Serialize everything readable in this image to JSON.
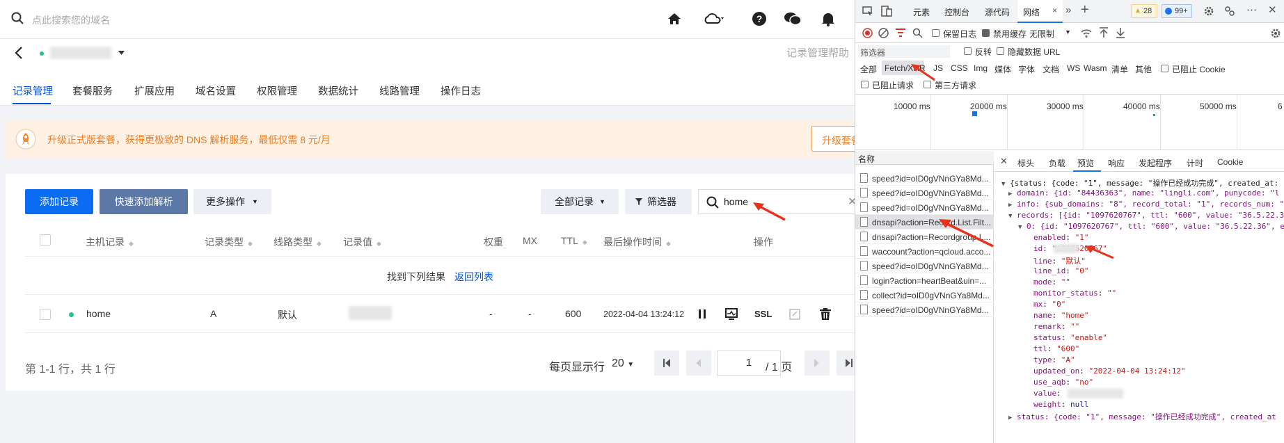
{
  "app": {
    "search_placeholder": "点此搜索您的域名",
    "help_link": "记录管理帮助",
    "tabs": [
      "记录管理",
      "套餐服务",
      "扩展应用",
      "域名设置",
      "权限管理",
      "数据统计",
      "线路管理",
      "操作日志"
    ],
    "banner": {
      "text": "升级正式版套餐，获得更极致的 DNS 解析服务，最低仅需 8 元/月",
      "button": "升级套餐"
    },
    "toolbar": {
      "add_record": "添加记录",
      "quick_add": "快速添加解析",
      "more_actions": "更多操作",
      "all_records": "全部记录",
      "filter": "筛选器",
      "search_value": "home"
    },
    "table": {
      "headers": [
        "主机记录",
        "记录类型",
        "线路类型",
        "记录值",
        "权重",
        "MX",
        "TTL",
        "最后操作时间",
        "操作"
      ],
      "found_text": "找到下列结果",
      "back_link": "返回列表",
      "row": {
        "host": "home",
        "type": "A",
        "line": "默认",
        "weight": "-",
        "mx": "-",
        "ttl": "600",
        "time": "2022-04-04 13:24:12",
        "ssl": "SSL"
      }
    },
    "pagination": {
      "summary": "第 1-1 行，共 1 行",
      "per_page_label": "每页显示行",
      "per_page": "20",
      "page": "1",
      "total_pages": "/ 1 页"
    }
  },
  "devtools": {
    "tabs": [
      "元素",
      "控制台",
      "源代码",
      "网络"
    ],
    "badges": {
      "warnings": "28",
      "messages": "99+"
    },
    "toolbar": {
      "preserve_log": "保留日志",
      "disable_cache": "禁用缓存",
      "throttle": "无限制"
    },
    "filter": {
      "placeholder": "筛选器",
      "invert": "反转",
      "hide_data_urls": "隐藏数据 URL"
    },
    "types": [
      "全部",
      "Fetch/XHR",
      "JS",
      "CSS",
      "Img",
      "媒体",
      "字体",
      "文档",
      "WS",
      "Wasm",
      "清单",
      "其他"
    ],
    "blocked_cookies": "已阻止 Cookie",
    "blocked_requests": "已阻止请求",
    "third_party": "第三方请求",
    "timeline": [
      "10000 ms",
      "20000 ms",
      "30000 ms",
      "40000 ms",
      "50000 ms",
      "6"
    ],
    "name_header": "名称",
    "requests": [
      "speed?id=oID0gVNnGYa8Md...",
      "speed?id=oID0gVNnGYa8Md...",
      "speed?id=oID0gVNnGYa8Md...",
      "dnsapi?action=Record.List.Filt...",
      "dnsapi?action=Recordgroup.L...",
      "waccount?action=qcloud.acco...",
      "speed?id=oID0gVNnGYa8Md...",
      "login?action=heartBeat&uin=...",
      "collect?id=oID0gVNnGYa8Md...",
      "speed?id=oID0gVNnGYa8Md..."
    ],
    "detail_tabs": [
      "标头",
      "负载",
      "预览",
      "响应",
      "发起程序",
      "计时",
      "Cookie"
    ],
    "preview": {
      "l1": "{status: {code: \"1\", message: \"操作已经成功完成\", created_at:",
      "l2": "domain: {id: \"84436363\", name: \"lingli.com\", punycode: \"l",
      "l3": "info: {sub_domains: \"8\", record_total: \"1\", records_num: \"",
      "l4": "records: [{id: \"1097620767\", ttl: \"600\", value: \"36.5.22.3",
      "l5": "0: {id: \"1097620767\", ttl: \"600\", value: \"36.5.22.36\", e",
      "enabled": "\"1\"",
      "id": "\"1097620767\"",
      "line": "\"默认\"",
      "line_id": "\"0\"",
      "mode": "\"\"",
      "monitor_status": "\"\"",
      "mx": "\"0\"",
      "name": "\"home\"",
      "remark": "\"\"",
      "status": "\"enable\"",
      "ttl": "\"600\"",
      "type": "\"A\"",
      "updated_on": "\"2022-04-04 13:24:12\"",
      "use_aqb": "\"no\"",
      "value": "",
      "weight": "null",
      "last": "status: {code: \"1\", message: \"操作已经成功完成\", created_at"
    }
  }
}
